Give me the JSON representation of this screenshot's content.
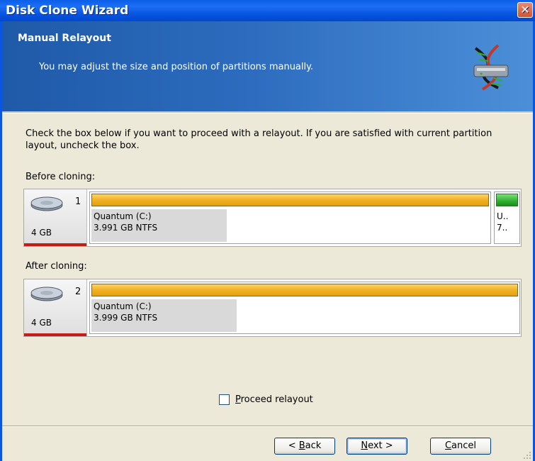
{
  "window": {
    "title": "Disk Clone Wizard",
    "close_glyph": "✕"
  },
  "banner": {
    "title": "Manual Relayout",
    "subtitle": "You may adjust the size and position of partitions manually.",
    "icon": "disk-clone-icon"
  },
  "instructions": "Check the box below if you want to proceed with a relayout. If you are satisfied with current partition layout, uncheck the box.",
  "before": {
    "label": "Before cloning:",
    "disk_number": "1",
    "disk_size": "4 GB",
    "partition": {
      "name": "Quantum (C:)",
      "fs": "3.991 GB  NTFS",
      "used_fraction": 0.34
    },
    "unallocated": {
      "line1": "U..",
      "line2": "7.."
    }
  },
  "after": {
    "label": "After cloning:",
    "disk_number": "2",
    "disk_size": "4 GB",
    "partition": {
      "name": "Quantum (C:)",
      "fs": "3.999 GB  NTFS",
      "used_fraction": 0.34
    }
  },
  "proceed": {
    "label": "Proceed relayout",
    "checked": false
  },
  "buttons": {
    "back": "< Back",
    "next": "Next >",
    "cancel": "Cancel"
  },
  "colors": {
    "partition_bar": "#f2b223",
    "unallocated_bar": "#2fae2f",
    "disk_marker": "#c41d17"
  }
}
